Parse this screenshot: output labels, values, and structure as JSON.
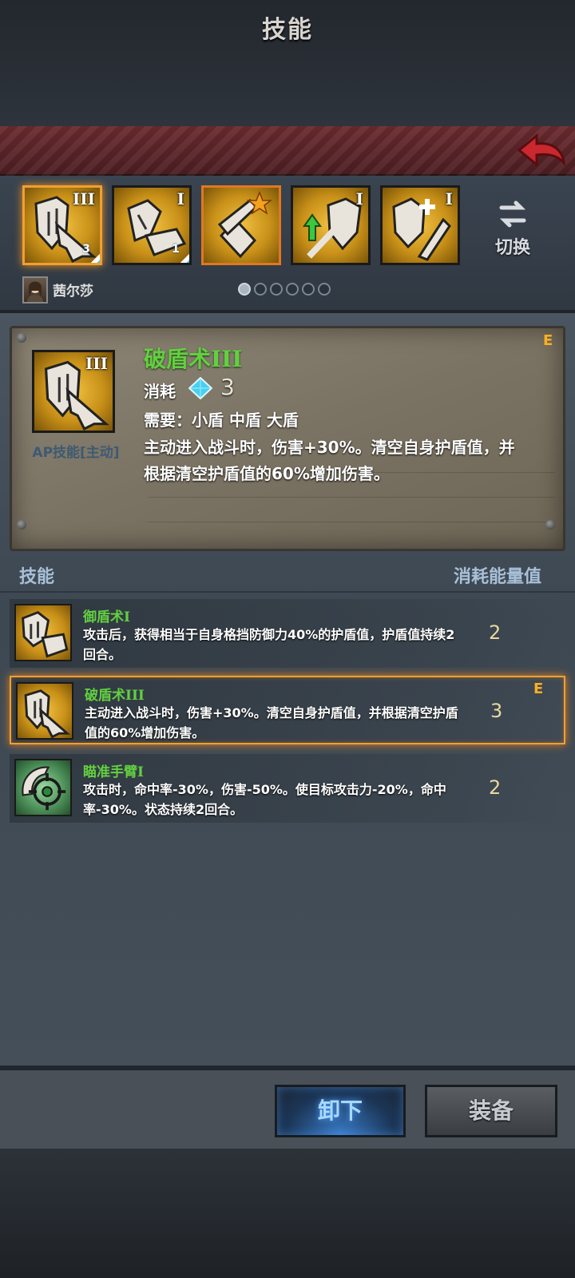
{
  "header": {
    "title": "技能"
  },
  "skill_bar": {
    "slots": [
      {
        "level": "III",
        "badge": "3",
        "selected": true
      },
      {
        "level": "I",
        "badge": "1",
        "selected": false
      },
      {
        "level": "",
        "badge": "",
        "selected": false,
        "star": true
      },
      {
        "level": "I",
        "badge": "",
        "selected": false
      },
      {
        "level": "I",
        "badge": "",
        "selected": false
      }
    ],
    "switch_label": "切换",
    "character_name": "茜尔莎",
    "page_dots": 6,
    "active_page": 0
  },
  "detail": {
    "name": "破盾术III",
    "level_roman": "III",
    "type": "AP技能[主动]",
    "cost_label": "消耗",
    "cost_value": "3",
    "requirement": "需要：小盾 中盾 大盾",
    "description": "主动进入战斗时，伤害+30%。清空自身护盾值，并根据清空护盾值的60%增加伤害。",
    "equipped_mark": "E"
  },
  "list": {
    "header_left": "技能",
    "header_right": "消耗能量值",
    "rows": [
      {
        "name": "御盾术I",
        "desc": "攻击后，获得相当于自身格挡防御力40%的护盾值，护盾值持续2回合。",
        "cost": "2",
        "equipped": "",
        "icon": "shield-break-icon"
      },
      {
        "name": "破盾术III",
        "desc": "主动进入战斗时，伤害+30%。清空自身护盾值，并根据清空护盾值的60%增加伤害。",
        "cost": "3",
        "equipped": "E",
        "icon": "shield-pierce-icon"
      },
      {
        "name": "瞄准手臂I",
        "desc": "攻击时，命中率-30%，伤害-50%。使目标攻击力-20%，命中率-30%。状态持续2回合。",
        "cost": "2",
        "equipped": "",
        "icon": "crosshair-icon"
      }
    ]
  },
  "footer": {
    "unequip_label": "卸下",
    "equip_label": "装备"
  },
  "colors": {
    "skill_name": "#62d040",
    "highlight": "#f0a030",
    "panel_red": "#6a2a2e"
  }
}
